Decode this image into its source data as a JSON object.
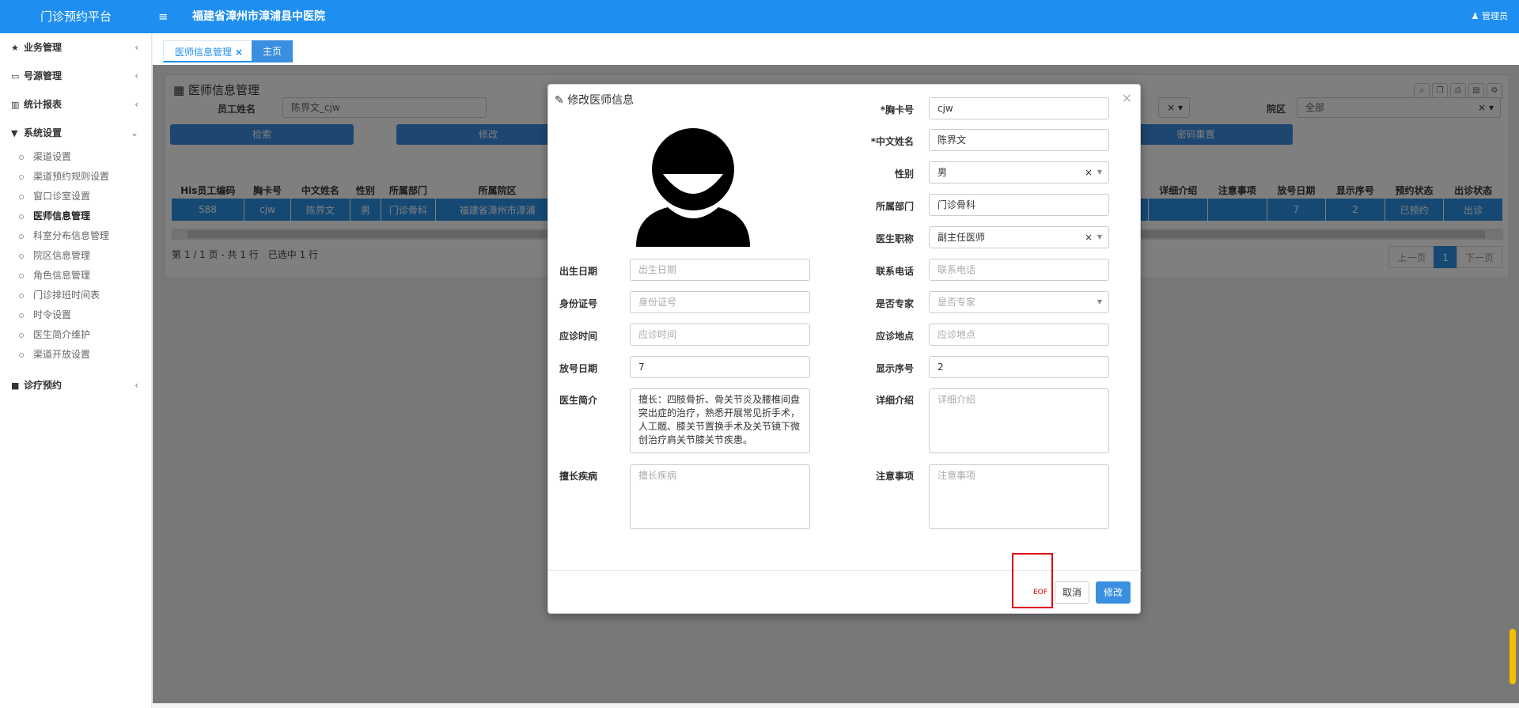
{
  "header": {
    "brand": "门诊预约平台",
    "menu_icon": "≡",
    "hospital": "福建省漳州市漳浦县中医院",
    "user": "管理员"
  },
  "sidebar": {
    "groups": [
      {
        "label": "业务管理",
        "icon": "star-icon"
      },
      {
        "label": "号源管理",
        "icon": "id-card-icon"
      },
      {
        "label": "统计报表",
        "icon": "bar-chart-icon"
      },
      {
        "label": "系统设置",
        "icon": "filter-icon"
      },
      {
        "label": "诊疗预约",
        "icon": "folder-icon"
      }
    ],
    "subitems": [
      "渠道设置",
      "渠道预约规则设置",
      "窗口诊室设置",
      "医师信息管理",
      "科室分布信息管理",
      "院区信息管理",
      "角色信息管理",
      "门诊排班时间表",
      "时令设置",
      "医生简介维护",
      "渠道开放设置"
    ]
  },
  "tabs": {
    "tab1": "医师信息管理",
    "tab2": "主页"
  },
  "panel": {
    "title": "医师信息管理",
    "filter": {
      "employee_name_label": "员工姓名",
      "employee_name_value": "陈界文_cjw",
      "campus_label": "院区",
      "campus_value": "全部"
    },
    "buttons": {
      "search": "检索",
      "modify": "修改",
      "reset_password": "密码重置"
    },
    "columns": [
      "His员工编码",
      "胸卡号",
      "中文姓名",
      "性别",
      "所属部门",
      "所属院区",
      "详细介绍",
      "注意事项",
      "放号日期",
      "显示序号",
      "预约状态",
      "出诊状态"
    ],
    "row": [
      "588",
      "cjw",
      "陈界文",
      "男",
      "门诊骨科",
      "福建省漳州市漳浦",
      "",
      "",
      "7",
      "2",
      "已预约",
      "出诊"
    ],
    "page_info": "第 1 / 1 页 - 共 1 行　已选中 1 行",
    "pager": {
      "prev": "上一页",
      "current": "1",
      "next": "下一页"
    }
  },
  "modal": {
    "title": "修改医师信息",
    "fields": {
      "badge_no_label": "*胸卡号",
      "badge_no": "cjw",
      "cn_name_label": "*中文姓名",
      "cn_name": "陈界文",
      "gender_label": "性别",
      "gender": "男",
      "dept_label": "所属部门",
      "dept": "门诊骨科",
      "title_label": "医生职称",
      "title": "副主任医师",
      "birth_label": "出生日期",
      "birth_placeholder": "出生日期",
      "phone_label": "联系电话",
      "phone_placeholder": "联系电话",
      "idcard_label": "身份证号",
      "idcard_placeholder": "身份证号",
      "expert_label": "是否专家",
      "expert_placeholder": "是否专家",
      "time_label": "应诊时间",
      "time_placeholder": "应诊时间",
      "place_label": "应诊地点",
      "place_placeholder": "应诊地点",
      "release_label": "放号日期",
      "release": "7",
      "order_label": "显示序号",
      "order": "2",
      "intro_label": "医生简介",
      "intro": "擅长：四肢骨折、骨关节炎及腰椎间盘突出症的治疗，熟悉开展常见折手术，人工髋、膝关节置换手术及关节镜下微创治疗肩关节膝关节疾患。",
      "detail_label": "详细介绍",
      "detail_placeholder": "详细介绍",
      "specialty_label": "擅长疾病",
      "specialty_placeholder": "擅长疾病",
      "notes_label": "注意事项",
      "notes_placeholder": "注意事项"
    },
    "eof": "EOF",
    "cancel": "取消",
    "submit": "修改"
  }
}
